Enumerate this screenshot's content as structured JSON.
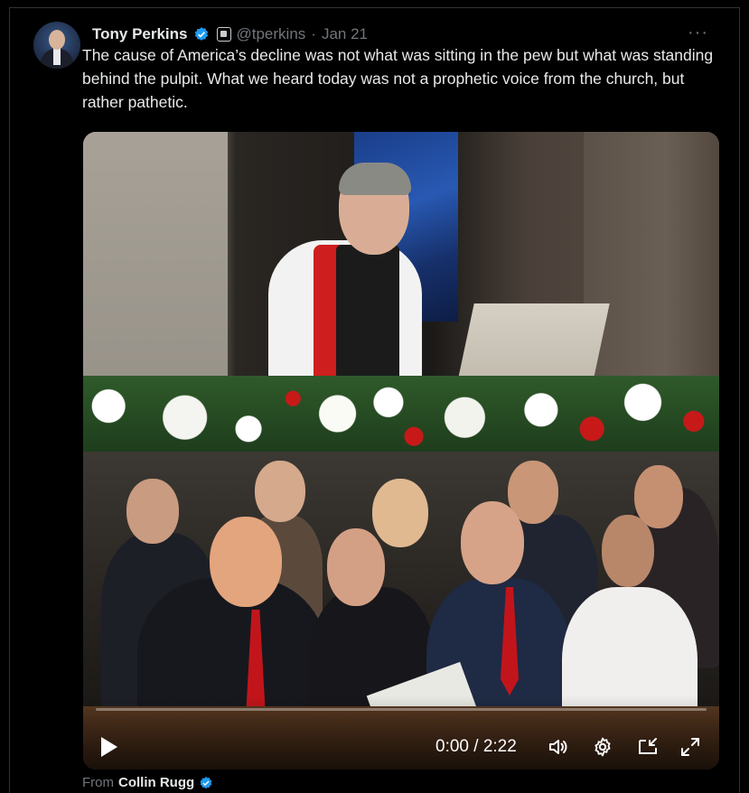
{
  "tweet": {
    "author_name": "Tony Perkins",
    "handle": "@tperkins",
    "separator": "·",
    "date": "Jan 21",
    "more_label": "···",
    "text": "The cause of America’s decline was not what was sitting in the pew but what was standing behind the pulpit.  What we heard today was not a prophetic voice from the church, but rather pathetic."
  },
  "video": {
    "time_display": "0:00 / 2:22",
    "progress": 0.0
  },
  "source": {
    "prefix": "From",
    "author": "Collin Rugg"
  },
  "icons": {
    "verified": "verified-badge-icon",
    "affiliate": "affiliate-badge-icon",
    "play": "play-icon",
    "volume": "volume-icon",
    "settings": "gear-icon",
    "minimize": "picture-in-picture-icon",
    "fullscreen": "fullscreen-icon"
  },
  "colors": {
    "background": "#000000",
    "text": "#e7e9ea",
    "muted": "#71767b",
    "accent": "#1d9bf0"
  }
}
